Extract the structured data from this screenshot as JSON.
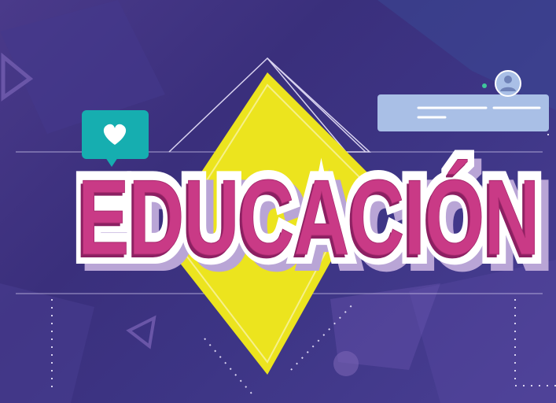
{
  "title": {
    "text": "EDUCACIÓN"
  },
  "colors": {
    "background": "#3d3585",
    "diamond": "#ece41e",
    "title_fill": "#c93a86",
    "title_outline": "#ffffff",
    "title_shadow": "#b9a5d6",
    "heart_bubble": "#16aeb0",
    "comment_card": "#a9bfe6",
    "accent_dot": "#3fc79b"
  },
  "icons": {
    "heart": "heart-icon",
    "user": "user-avatar-icon",
    "triangle": "triangle-outline-icon"
  }
}
